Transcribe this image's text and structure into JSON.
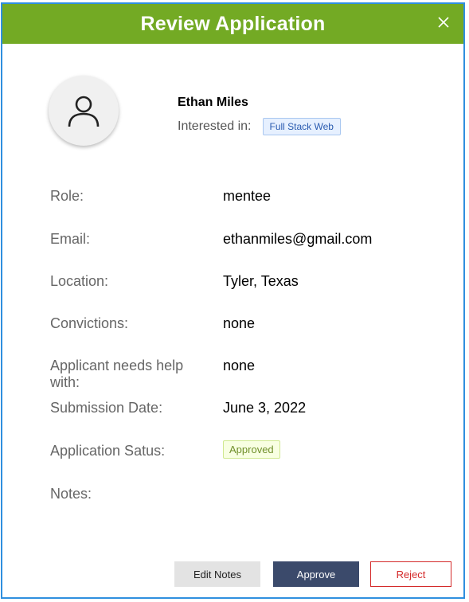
{
  "modal": {
    "title": "Review Application",
    "close_icon": "close-icon",
    "border_color": "#2f8fdf",
    "header_color": "#73aa24"
  },
  "applicant": {
    "avatar_icon": "user-icon",
    "name": "Ethan Miles",
    "interest_label": "Interested in:",
    "interest_tag": "Full Stack Web"
  },
  "fields": {
    "role_label": "Role:",
    "role_value": "mentee",
    "email_label": "Email:",
    "email_value": "ethanmiles@gmail.com",
    "location_label": "Location:",
    "location_value": "Tyler, Texas",
    "convictions_label": "Convictions:",
    "convictions_value": "none",
    "help_label": "Applicant needs help with:",
    "help_value": "none",
    "submission_label": "Submission Date:",
    "submission_value": "June 3, 2022",
    "status_label": "Application Satus:",
    "status_value": "Approved",
    "notes_label": "Notes:"
  },
  "actions": {
    "edit_notes_label": "Edit Notes",
    "approve_label": "Approve",
    "reject_label": "Reject",
    "approve_color": "#3b4a6b",
    "reject_color": "#d42a2a"
  }
}
